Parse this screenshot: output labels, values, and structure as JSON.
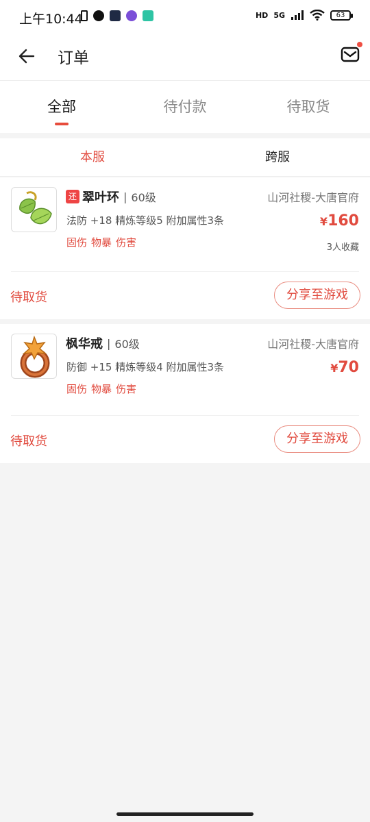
{
  "status_bar": {
    "time": "上午10:44",
    "network": "5G",
    "hd": "HD",
    "battery": "63"
  },
  "header": {
    "title": "订单"
  },
  "main_tabs": [
    {
      "label": "全部",
      "active": true
    },
    {
      "label": "待付款",
      "active": false
    },
    {
      "label": "待取货",
      "active": false
    }
  ],
  "server_tabs": [
    {
      "label": "本服",
      "active": true
    },
    {
      "label": "跨服",
      "active": false
    }
  ],
  "orders": [
    {
      "tag": "还",
      "name": "翠叶环",
      "level": "60级",
      "server": "山河社稷-大唐官府",
      "attrs": "法防 +18 精炼等级5 附加属性3条",
      "tags": [
        "固伤",
        "物暴",
        "伤害"
      ],
      "currency": "¥",
      "price": "160",
      "favorites": "3人收藏",
      "status": "待取货",
      "share_label": "分享至游戏",
      "icon": "leaf-ring-icon"
    },
    {
      "name": "枫华戒",
      "level": "60级",
      "server": "山河社稷-大唐官府",
      "attrs": "防御 +15 精炼等级4 附加属性3条",
      "tags": [
        "固伤",
        "物暴",
        "伤害"
      ],
      "currency": "¥",
      "price": "70",
      "status": "待取货",
      "share_label": "分享至游戏",
      "icon": "maple-ring-icon"
    }
  ],
  "colors": {
    "accent": "#e14b3f",
    "background": "#f4f4f4"
  }
}
